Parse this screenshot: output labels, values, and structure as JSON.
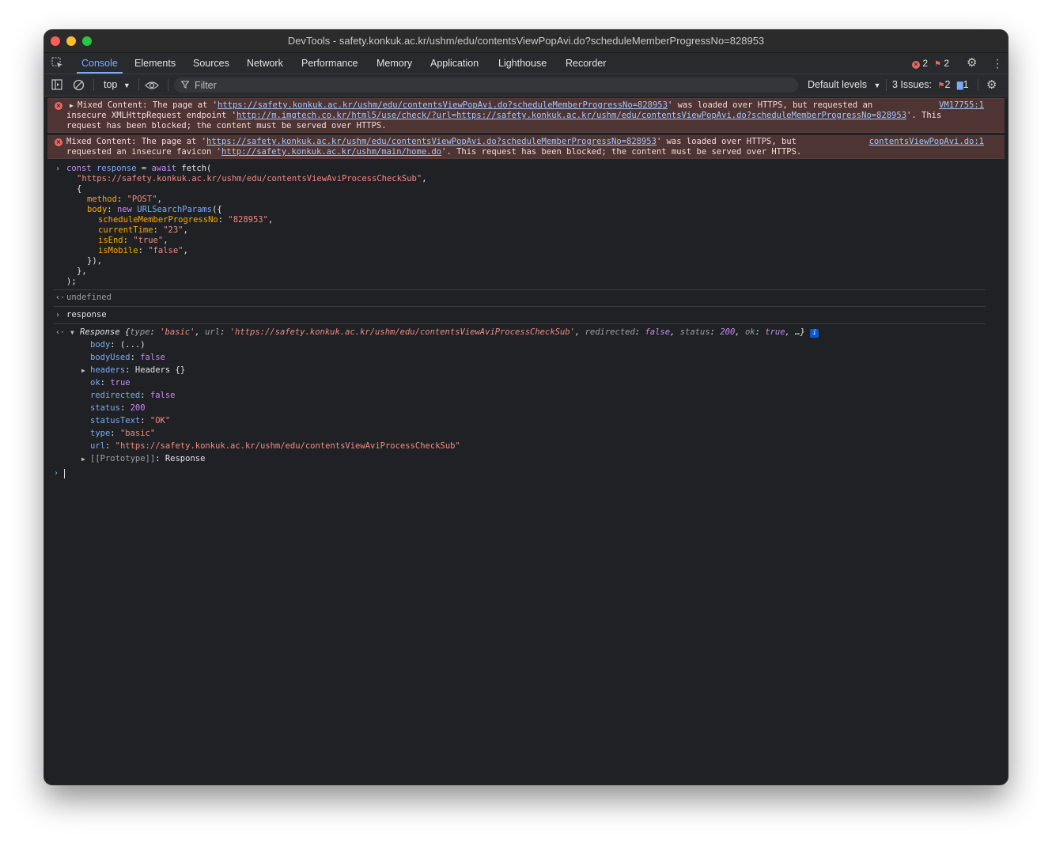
{
  "window": {
    "title": "DevTools - safety.konkuk.ac.kr/ushm/edu/contentsViewPopAvi.do?scheduleMemberProgressNo=828953"
  },
  "tabs": [
    "Console",
    "Elements",
    "Sources",
    "Network",
    "Performance",
    "Memory",
    "Application",
    "Lighthouse",
    "Recorder"
  ],
  "active_tab": "Console",
  "status_counts": {
    "errors": "2",
    "warnings": "2"
  },
  "toolbar": {
    "context": "top",
    "filter_placeholder": "Filter",
    "levels": "Default levels",
    "issues_label": "3 Issues:",
    "issues_errors": "2",
    "issues_info": "1"
  },
  "messages": {
    "error1": {
      "source": "VM17755:1",
      "prefix1": "Mixed Content: The page at '",
      "url1": "https://safety.konkuk.ac.kr/ushm/edu/contentsViewPopAvi.do?scheduleMemberProgressNo=828953",
      "suffix1": "' was loaded over HTTPS, but requested an",
      "prefix2": "insecure XMLHttpRequest endpoint '",
      "url2": "http://m.imgtech.co.kr/html5/use/check/?url=https://safety.konkuk.ac.kr/ushm/edu/contentsViewPopAvi.do?scheduleMemberProgressNo=828953",
      "suffix2": "'. This",
      "line3": "request has been blocked; the content must be served over HTTPS."
    },
    "error2": {
      "source": "contentsViewPopAvi.do:1",
      "prefix1": "Mixed Content: The page at '",
      "url1": "https://safety.konkuk.ac.kr/ushm/edu/contentsViewPopAvi.do?scheduleMemberProgressNo=828953",
      "suffix1": "' was loaded over HTTPS, but",
      "prefix2": "requested an insecure favicon '",
      "url2": "http://safety.konkuk.ac.kr/ushm/main/home.do",
      "suffix2": "'. This request has been blocked; the content must be served over HTTPS."
    }
  },
  "code": {
    "kw_const": "const",
    "var_response": "response",
    "eq_await": " = ",
    "kw_await": "await",
    "fetch_open": " fetch(",
    "url": "\"https://safety.konkuk.ac.kr/ushm/edu/contentsViewAviProcessCheckSub\"",
    "comma": ",",
    "brace_open": "{",
    "method_key": "method",
    "method_val": "\"POST\"",
    "body_key": "body",
    "kw_new": "new",
    "usp": "URLSearchParams",
    "usp_open": "({",
    "p1_key": "scheduleMemberProgressNo",
    "p1_val": "\"828953\"",
    "p2_key": "currentTime",
    "p2_val": "\"23\"",
    "p3_key": "isEnd",
    "p3_val": "\"true\"",
    "p4_key": "isMobile",
    "p4_val": "\"false\"",
    "close1": "}),",
    "close2": "},",
    "close3": ");"
  },
  "result_undefined": "undefined",
  "input2": "response",
  "response_obj": {
    "label": "Response",
    "summary_open": " {",
    "s_type_k": "type",
    "s_type_v": "'basic'",
    "s_url_k": "url",
    "s_url_v": "'https://safety.konkuk.ac.kr/ushm/edu/contentsViewAviProcessCheckSub'",
    "s_red_k": "redirected",
    "s_red_v": "false",
    "s_status_k": "status",
    "s_status_v": "200",
    "s_ok_k": "ok",
    "s_ok_v": "true",
    "summary_close": ", …}",
    "info_badge": "i",
    "props": [
      {
        "key": "body",
        "value": "(...)"
      },
      {
        "key": "bodyUsed",
        "value": "false"
      },
      {
        "key": "headers",
        "value": "Headers {}"
      },
      {
        "key": "ok",
        "value": "true"
      },
      {
        "key": "redirected",
        "value": "false"
      },
      {
        "key": "status",
        "value": "200"
      },
      {
        "key": "statusText",
        "value": "\"OK\""
      },
      {
        "key": "type",
        "value": "\"basic\""
      },
      {
        "key": "url",
        "value": "\"https://safety.konkuk.ac.kr/ushm/edu/contentsViewAviProcessCheckSub\""
      },
      {
        "key": "[[Prototype]]",
        "value": "Response"
      }
    ]
  },
  "colors": {
    "background": "#202124",
    "accent": "#7cacf8",
    "error_bg": "#4e3534",
    "string": "#f28b82",
    "keyword": "#c58af9"
  }
}
